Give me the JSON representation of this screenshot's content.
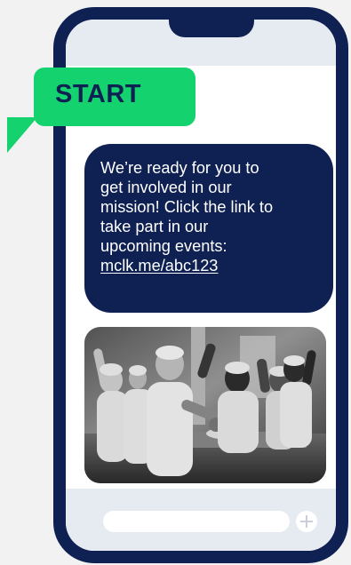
{
  "start_tag": {
    "label": "START"
  },
  "message": {
    "lines": [
      "We’re ready for you to",
      "get involved in our",
      "mission! Click the link to",
      "take part in our",
      "upcoming events:"
    ],
    "link": "mclk.me/abc123"
  },
  "photo": {
    "alt": "Volunteers in white hairnets cheering"
  },
  "composer": {
    "add_icon": "plus-icon"
  },
  "colors": {
    "phone": "#0f2152",
    "bubble": "#0f2152",
    "start_green": "#14d36f",
    "screen_bar": "#e6eaf1"
  }
}
